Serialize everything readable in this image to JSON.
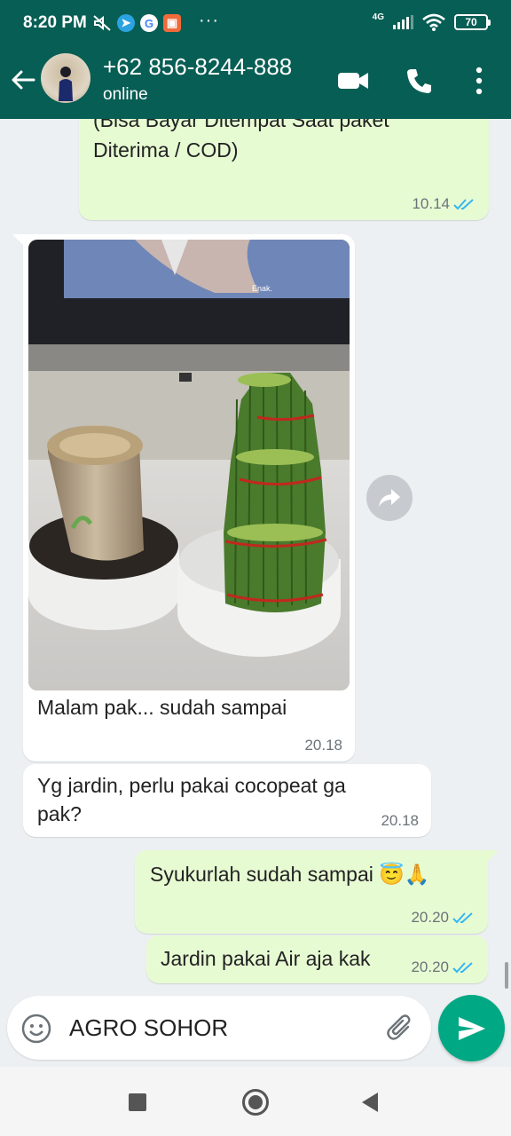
{
  "status_bar": {
    "time": "8:20 PM",
    "network": "4G",
    "battery": "70",
    "more": "···"
  },
  "header": {
    "contact_name": "+62 856-8244-888",
    "status": "online",
    "icons": [
      "back-arrow-icon",
      "video-call-icon",
      "phone-icon",
      "more-vert-icon"
    ]
  },
  "messages": [
    {
      "direction": "outgoing",
      "lines": [
        "(Bisa Bayar Ditempat Saat paket",
        "Diterima / COD)"
      ],
      "time": "10.14",
      "read": true
    },
    {
      "direction": "incoming",
      "type": "image",
      "caption": "Malam pak... sudah sampai",
      "time": "20.18",
      "tv_caption": "Enak."
    },
    {
      "direction": "incoming",
      "text": "Yg jardin, perlu pakai cocopeat ga pak?",
      "time": "20.18"
    },
    {
      "direction": "outgoing",
      "text": "Syukurlah sudah sampai 😇🙏",
      "time": "20.20",
      "read": true
    },
    {
      "direction": "outgoing",
      "text": "Jardin pakai Air aja kak",
      "time": "20.20",
      "read": true
    }
  ],
  "composer": {
    "text": "AGRO SOHOR"
  },
  "colors": {
    "header": "#075e54",
    "outgoing_bubble": "#e7fbd3",
    "incoming_bubble": "#ffffff",
    "send_button": "#00a884",
    "read_ticks": "#34b7f1"
  }
}
